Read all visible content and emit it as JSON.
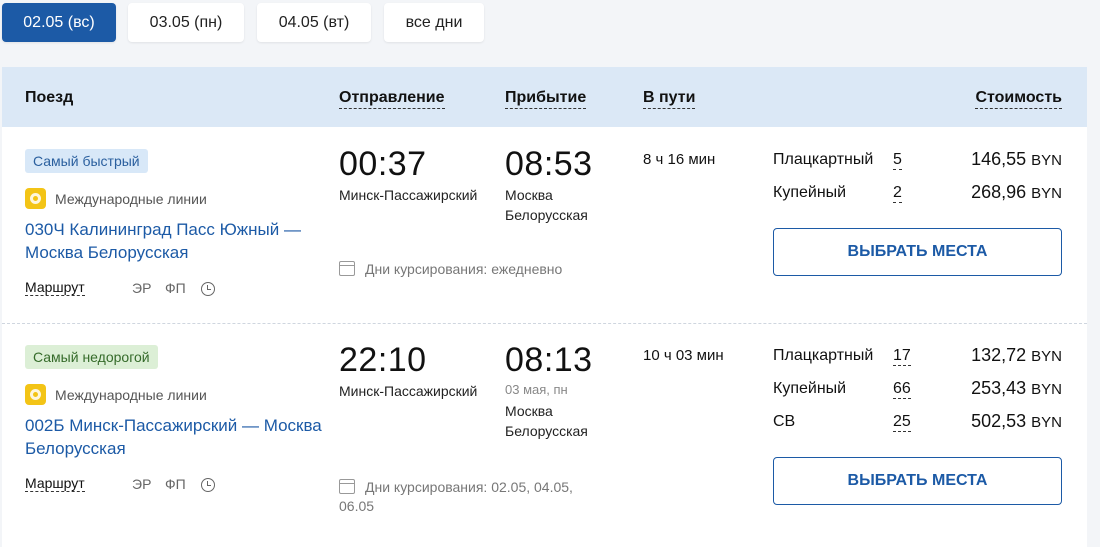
{
  "date_tabs": [
    {
      "label": "02.05 (вс)",
      "active": true
    },
    {
      "label": "03.05 (пн)",
      "active": false
    },
    {
      "label": "04.05 (вт)",
      "active": false
    },
    {
      "label": "все дни",
      "active": false
    }
  ],
  "table_header": {
    "train": "Поезд",
    "departure": "Отправление",
    "arrival": "Прибытие",
    "duration": "В пути",
    "cost": "Стоимость"
  },
  "trains": [
    {
      "badge": "Самый быстрый",
      "category": "Международные линии",
      "name": "030Ч Калининград Пасс Южный — Москва Белорусская",
      "route_link": "Маршрут",
      "tag_er": "ЭР",
      "tag_fp": "ФП",
      "dep_time": "00:37",
      "dep_station": "Минск-Пассажирский",
      "arr_time": "08:53",
      "arr_date": "",
      "arr_station_1": "Москва",
      "arr_station_2": "Белорусская",
      "duration": "8 ч 16 мин",
      "days_label": "Дни курсирования: ежедневно",
      "days_label_2": "",
      "classes": [
        {
          "name": "Плацкартный",
          "seats": "5",
          "price": "146,55",
          "currency": "BYN"
        },
        {
          "name": "Купейный",
          "seats": "2",
          "price": "268,96",
          "currency": "BYN"
        }
      ],
      "button": "ВЫБРАТЬ МЕСТА"
    },
    {
      "badge": "Самый недорогой",
      "category": "Международные линии",
      "name": "002Б Минск-Пассажирский — Москва Белорусская",
      "route_link": "Маршрут",
      "tag_er": "ЭР",
      "tag_fp": "ФП",
      "dep_time": "22:10",
      "dep_station": "Минск-Пассажирский",
      "arr_time": "08:13",
      "arr_date": "03 мая, пн",
      "arr_station_1": "Москва",
      "arr_station_2": "Белорусская",
      "duration": "10 ч 03 мин",
      "days_label": "Дни курсирования: 02.05, 04.05,",
      "days_label_2": "06.05",
      "classes": [
        {
          "name": "Плацкартный",
          "seats": "17",
          "price": "132,72",
          "currency": "BYN"
        },
        {
          "name": "Купейный",
          "seats": "66",
          "price": "253,43",
          "currency": "BYN"
        },
        {
          "name": "СВ",
          "seats": "25",
          "price": "502,53",
          "currency": "BYN"
        }
      ],
      "button": "ВЫБРАТЬ МЕСТА"
    }
  ],
  "colors": {
    "accent": "#1c5aa6",
    "header_bg": "#dbe8f6",
    "badge_fast_bg": "#d8e8f8",
    "badge_cheap_bg": "#dcefd6",
    "intl_icon": "#f3c416"
  }
}
